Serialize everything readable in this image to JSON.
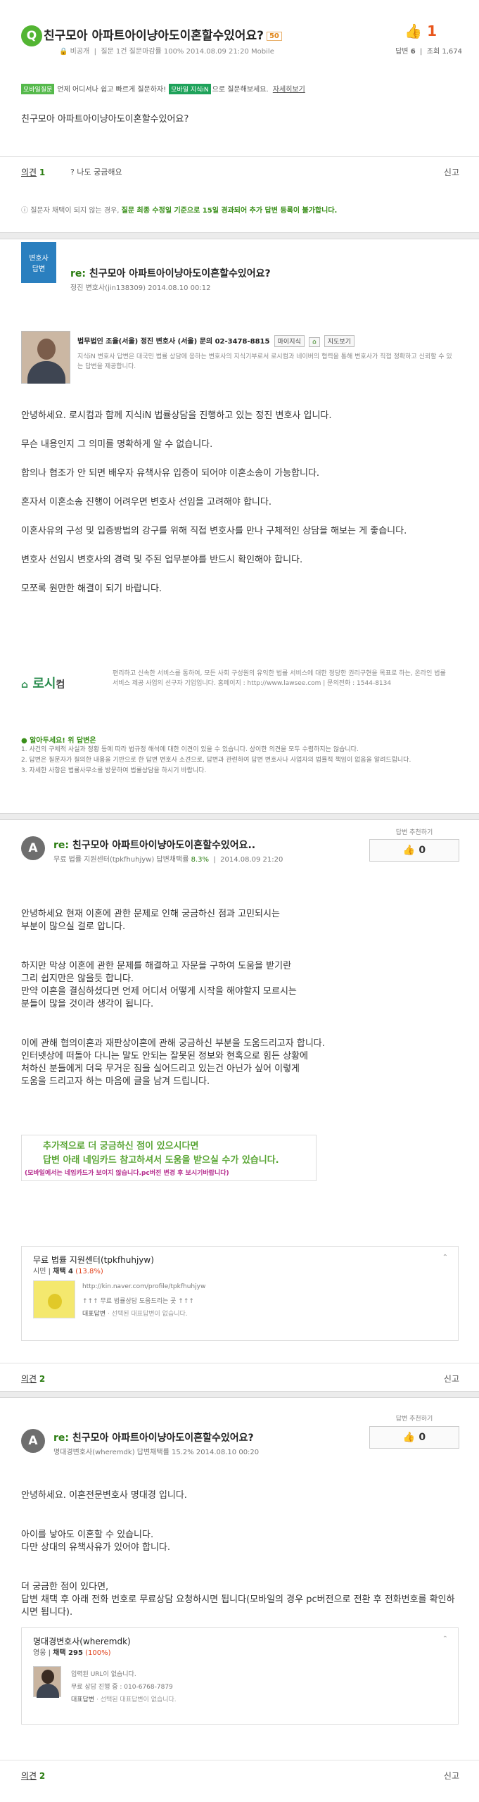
{
  "question": {
    "badge_letter": "Q",
    "title": "친구모아 아파트아이냥아도이혼할수있어요?",
    "points": "50",
    "author": "비공개",
    "meta": "질문 1건 질문마감률 100%   2014.08.09 21:20   Mobile",
    "adopt_rate": "100%",
    "like_count": "1",
    "answers_label": "답변",
    "answers": "6",
    "views_label": "조회",
    "views": "1,674",
    "body": "친구모아 아파트아이냥아도이혼할수있어요?"
  },
  "mobile_bar": {
    "tag": "모바일질문",
    "text": "언제 어디서나 쉽고 빠르게 질문하자!",
    "tag2": "모바일 지식iN",
    "text2": "으로 질문해보세요.",
    "link": "자세히보기"
  },
  "opinion1": {
    "label": "의견",
    "count": "1",
    "curious": "나도 궁금해요",
    "report": "신고"
  },
  "notice": {
    "prefix": "질문자 채택이 되지 않는 경우,",
    "bold": "질문 최종 수정일 기준으로 15일 경과되어 추가 답변 등록이 불가합니다."
  },
  "answer1": {
    "flag_line1": "변호사",
    "flag_line2": "답변",
    "title_re": "re:",
    "title": "친구모아 아파트아이냥아도이혼할수있어요?",
    "sub": "정진 변호사(jin138309)   2014.08.10 00:12",
    "profile_line": "법무법인 조율(서울)   정진 변호사 (서울)   문의 02-3478-8815",
    "btn1": "마이지식",
    "btn2": "지도보기",
    "profile_desc": "지식iN 변호사 답변은 대국민 법률 상담에 응하는 변호사의 지식기부로서 로시컴과 네이버의 협력을 통해 변호사가 직접 정확하고 신뢰할 수 있는 답변을 제공합니다.",
    "paragraphs": [
      "안녕하세요. 로시컴과 함께 지식iN 법률상담을 진행하고 있는 정진 변호사 입니다.",
      "무슨 내용인지 그 의미를 명확하게 알 수 없습니다.",
      "합의나 협조가 안 되면 배우자 유책사유 입증이 되어야 이혼소송이 가능합니다.",
      "혼자서 이혼소송 진행이 어려우면 변호사 선임을 고려해야 합니다.",
      "이혼사유의 구성 및 입증방법의 강구를 위해 직접 변호사를 만나 구체적인 상담을 해보는 게 좋습니다.",
      "변호사 선임시 변호사의 경력 및 주된 업무분야를 반드시 확인해야 합니다.",
      "모쪼록 원만한 해결이 되기 바랍니다."
    ],
    "logo_text": "로시",
    "logo_suffix": "컴",
    "law_desc": "편리하고 신속한 서비스를 통하여, 모든 사회 구성원의 유익한 법률 서비스에 대한 정당한 권리구현을 목표로 하는, 온라인 법률서비스 제공 사업의 선구자 기업입니다. 홈페이지 : http://www.lawsee.com  |  문의전화 : 1544-8134",
    "agree_title": "알아두세요! 위 답변은",
    "agree_items": [
      "1. 사건의 구체적 사실과 정황 등에 따라 법규정 해석에 대한 이견이 있을 수 있습니다. 상이한 의견을 모두 수렴하지는 않습니다.",
      "2. 답변은 질문자가 질의한 내용을 기반으로 한 답변 변호사 소견으로, 답변과 관련하여 답변 변호사나 사업자의 법률적 책임이 없음을 알려드립니다.",
      "3. 자세한 사항은 법률사무소를 방문하여 법률상담을 하시기 바랍니다."
    ]
  },
  "answer2": {
    "avatar_letter": "A",
    "title_re": "re:",
    "title": "친구모아 아파트아이냥아도이혼할수있어요..",
    "sub_prefix": "무료 법률 지원센터(tpkfhuhjyw)   답변채택률",
    "rate": "8.3%",
    "sub_date": "2014.08.09 21:20",
    "choose_label": "답변 추천하기",
    "likes": "0",
    "paragraphs": [
      "안녕하세요 현재 이혼에 관한 문제로 인해 궁금하신 점과 고민되시는\n부분이 많으실 걸로 압니다.",
      "하지만 막상 이혼에 관한 문제를 해결하고 자문을 구하여 도움을 받기란\n그리 쉽지만은 않을듯 합니다.\n만약 이혼을 결심하셨다면 언제 어디서 어떻게 시작을 해야할지 모르시는\n분들이 많을 것이라 생각이 됩니다.",
      "이에 관해 협의이혼과 재판상이혼에 관해 궁금하신 부분을 도움드리고자 합니다.\n인터넷상에 떠돌아 다니는 말도 안되는 잘못된 정보와 현혹으로 힘든 상황에\n처하신 분들에게 더욱 무거운 짐을 실어드리고 있는건 아닌가 싶어 이렇게\n도움을 드리고자 하는 마음에 글을 남겨 드립니다."
    ],
    "ad_line1": "추가적으로 더 궁금하신 점이 있으시다면",
    "ad_line2": "답변 아래 네임카드 참고하셔서 도움을 받으실 수가 있습니다.",
    "ad_line3": "(모바일에서는 네임카드가 보이지 않습니다.pc버전 변경 후 보시기바랍니다)",
    "card_name": "무료 법률 지원센터(tpkfhuhjyw)",
    "card_grade": "시민",
    "card_adopt": "채택 4",
    "card_pct": "(13.8%)",
    "card_url": "http://kin.naver.com/profile/tpkfhuhjyw",
    "card_tags": "↑↑↑ 무료 법률상담 도움드리는 곳 ↑↑↑",
    "card_rep_label": "대표답변",
    "card_rep": "· 선택된 대표답변이 없습니다.",
    "opinion_label": "의견",
    "opinion_count": "2",
    "report": "신고"
  },
  "answer3": {
    "avatar_letter": "A",
    "title_re": "re:",
    "title": "친구모아 아파트아이냥아도이혼할수있어요?",
    "sub": "명대경변호사(wheremdk)   답변채택률 15.2%   2014.08.10 00:20",
    "choose_label": "답변 추천하기",
    "likes": "0",
    "paragraphs": [
      "안녕하세요. 이혼전문변호사 명대경 입니다.",
      "아이를 낳아도 이혼할 수 있습니다.\n다만 상대의 유책사유가 있어야 합니다.",
      "더 궁금한 점이 있다면,\n답변 채택 후 아래 전화 번호로 무료상담 요청하시면 됩니다(모바일의 경우 pc버전으로 전환 후 전화번호를 확인하시면 됩니다)."
    ],
    "card_name": "명대경변호사(wheremdk)",
    "card_grade": "영웅",
    "card_adopt": "채택 295",
    "card_pct": "(100%)",
    "card_url": "입력된 URL이 없습니다.",
    "card_tags": "무료 상담 진행 중 : 010-6768-7879",
    "card_rep_label": "대표답변",
    "card_rep": "· 선택된 대표답변이 없습니다.",
    "opinion_label": "의견",
    "opinion_count": "2",
    "report": "신고"
  }
}
